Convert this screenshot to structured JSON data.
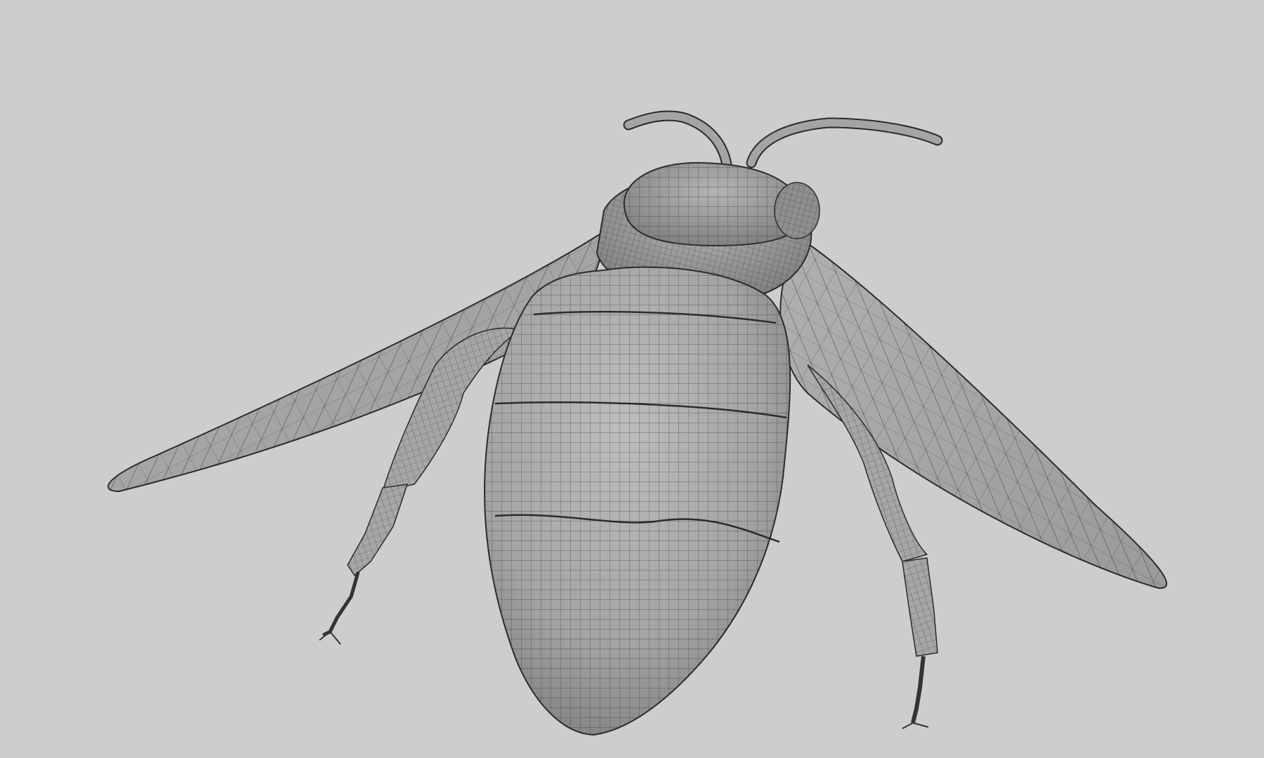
{
  "viewport": {
    "background": "#cdcdcd",
    "shade_light": "#b7b7b7",
    "shade_mid": "#9c9c9c",
    "shade_dark": "#6f6f6f",
    "wing_fill": "#a9a9a9",
    "wire_color": "#2b2b2b"
  },
  "model": {
    "subject": "wasp-wireframe-mesh",
    "parts": [
      "left-antenna",
      "right-antenna",
      "head",
      "thorax",
      "left-wing",
      "right-wing",
      "left-leg",
      "right-leg",
      "abdomen"
    ]
  }
}
